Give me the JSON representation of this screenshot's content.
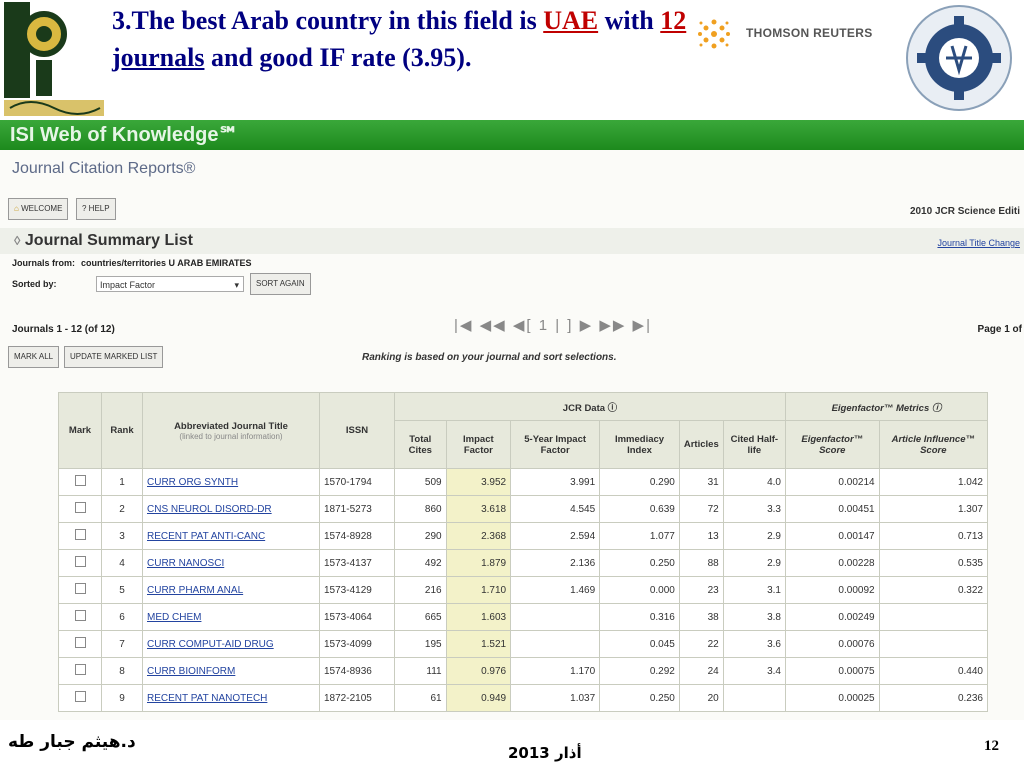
{
  "slide": {
    "headline_part1": "3.The best Arab country in this field is",
    "headline_country": "UAE",
    "headline_with": " with ",
    "headline_count": "12",
    "headline_journals": " journals",
    "headline_part2": " and good IF rate (3.95).",
    "thomson_label": "THOMSON REUTERS",
    "footer_author": "د.هيثم جبار طه",
    "footer_date": "أذار 2013",
    "footer_page": "12",
    "colors": {
      "headline": "#000080",
      "accent": "#c00000",
      "isi_green": "#2a9a2a"
    }
  },
  "jcr": {
    "brand": "ISI Web of Knowledge℠",
    "product": "Journal Citation Reports®",
    "welcome_btn": "WELCOME",
    "help_btn": "? HELP",
    "edition": "2010 JCR Science Editi",
    "summary_title": "Journal Summary List",
    "title_changes_link": "Journal Title Change",
    "journals_from_label": "Journals from:",
    "journals_from_value": "countries/territories U ARAB EMIRATES",
    "sorted_by_label": "Sorted by:",
    "sorted_by_value": "Impact Factor",
    "sort_again_btn": "SORT AGAIN",
    "journals_count": "Journals 1 - 12 (of 12)",
    "pager": "|◀ ◀◀ ◀[ 1 | ] ▶ ▶▶ ▶|",
    "page_of": "Page 1 of",
    "mark_all_btn": "MARK ALL",
    "update_marked_btn": "UPDATE MARKED LIST",
    "ranking_note": "Ranking is based on your journal and sort selections.",
    "headers": {
      "mark": "Mark",
      "rank": "Rank",
      "title": "Abbreviated Journal Title",
      "title_sub": "(linked to journal information)",
      "issn": "ISSN",
      "jcr_data": "JCR Data ⓘ",
      "eigen": "Eigenfactor™ Metrics ⓘ",
      "total_cites": "Total Cites",
      "impact_factor": "Impact Factor",
      "five_year": "5-Year Impact Factor",
      "immediacy": "Immediacy Index",
      "articles": "Articles",
      "half_life": "Cited Half-life",
      "eigen_score": "Eigenfactor™ Score",
      "influence": "Article Influence™ Score"
    },
    "rows": [
      {
        "rank": "1",
        "title": "CURR ORG SYNTH",
        "issn": "1570-1794",
        "cites": "509",
        "if": "3.952",
        "fy": "3.991",
        "imm": "0.290",
        "art": "31",
        "hl": "4.0",
        "eig": "0.00214",
        "ai": "1.042"
      },
      {
        "rank": "2",
        "title": "CNS NEUROL DISORD-DR",
        "issn": "1871-5273",
        "cites": "860",
        "if": "3.618",
        "fy": "4.545",
        "imm": "0.639",
        "art": "72",
        "hl": "3.3",
        "eig": "0.00451",
        "ai": "1.307"
      },
      {
        "rank": "3",
        "title": "RECENT PAT ANTI-CANC",
        "issn": "1574-8928",
        "cites": "290",
        "if": "2.368",
        "fy": "2.594",
        "imm": "1.077",
        "art": "13",
        "hl": "2.9",
        "eig": "0.00147",
        "ai": "0.713"
      },
      {
        "rank": "4",
        "title": "CURR NANOSCI",
        "issn": "1573-4137",
        "cites": "492",
        "if": "1.879",
        "fy": "2.136",
        "imm": "0.250",
        "art": "88",
        "hl": "2.9",
        "eig": "0.00228",
        "ai": "0.535"
      },
      {
        "rank": "5",
        "title": "CURR PHARM ANAL",
        "issn": "1573-4129",
        "cites": "216",
        "if": "1.710",
        "fy": "1.469",
        "imm": "0.000",
        "art": "23",
        "hl": "3.1",
        "eig": "0.00092",
        "ai": "0.322"
      },
      {
        "rank": "6",
        "title": "MED CHEM",
        "issn": "1573-4064",
        "cites": "665",
        "if": "1.603",
        "fy": "",
        "imm": "0.316",
        "art": "38",
        "hl": "3.8",
        "eig": "0.00249",
        "ai": ""
      },
      {
        "rank": "7",
        "title": "CURR COMPUT-AID DRUG",
        "issn": "1573-4099",
        "cites": "195",
        "if": "1.521",
        "fy": "",
        "imm": "0.045",
        "art": "22",
        "hl": "3.6",
        "eig": "0.00076",
        "ai": ""
      },
      {
        "rank": "8",
        "title": "CURR BIOINFORM",
        "issn": "1574-8936",
        "cites": "111",
        "if": "0.976",
        "fy": "1.170",
        "imm": "0.292",
        "art": "24",
        "hl": "3.4",
        "eig": "0.00075",
        "ai": "0.440"
      },
      {
        "rank": "9",
        "title": "RECENT PAT NANOTECH",
        "issn": "1872-2105",
        "cites": "61",
        "if": "0.949",
        "fy": "1.037",
        "imm": "0.250",
        "art": "20",
        "hl": "",
        "eig": "0.00025",
        "ai": "0.236"
      }
    ]
  }
}
